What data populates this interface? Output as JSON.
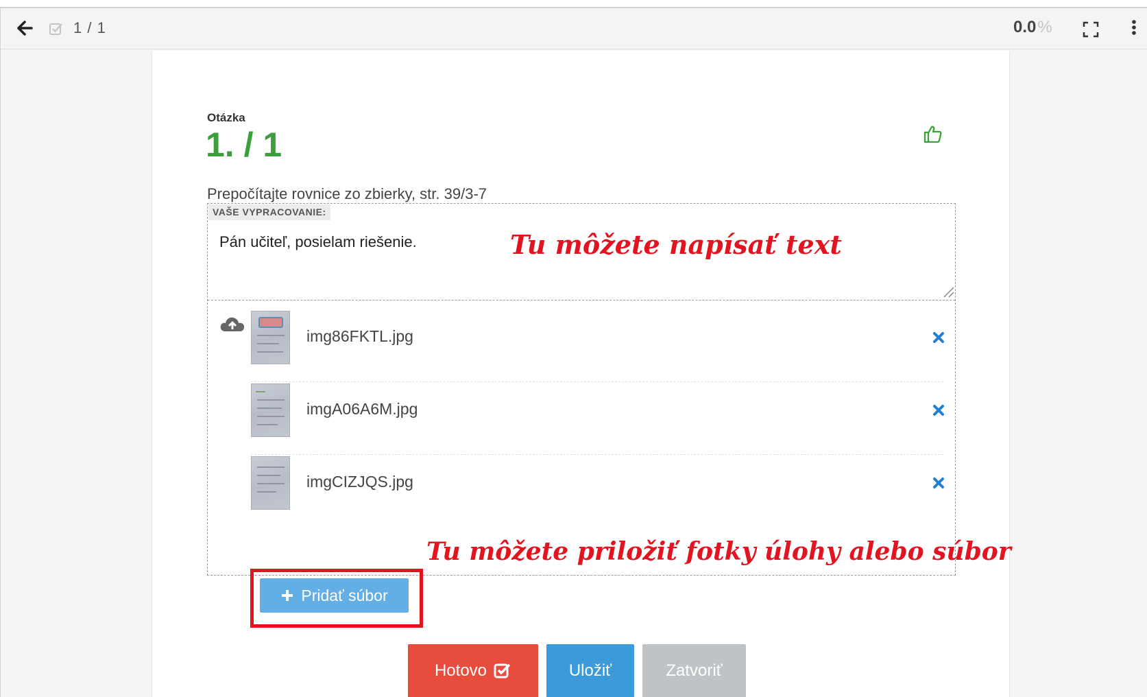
{
  "toolbar": {
    "counter": "1 / 1",
    "percent_value": "0.0",
    "percent_unit": "%"
  },
  "question": {
    "label": "Otázka",
    "number": "1. / 1",
    "text": "Prepočítajte rovnice zo zbierky, str. 39/3-7"
  },
  "answer": {
    "label": "VAŠE VYPRACOVANIE:",
    "text": "Pán učiteľ, posielam riešenie."
  },
  "files": [
    {
      "name": "img86FKTL.jpg"
    },
    {
      "name": "imgA06A6M.jpg"
    },
    {
      "name": "imgCIZJQS.jpg"
    }
  ],
  "add_file_label": "Pridať súbor",
  "annotations": {
    "text_hint": "Tu môžete napísať text",
    "file_hint": "Tu môžete priložiť fotky úlohy alebo súbor"
  },
  "buttons": {
    "done": "Hotovo",
    "save": "Uložiť",
    "close": "Zatvoriť"
  },
  "colors": {
    "accent_green": "#3aa13a",
    "done_red": "#e84c3d",
    "save_blue": "#3b9ad9",
    "close_gray": "#c0c3c5",
    "add_blue": "#63aee5",
    "annotation_red": "#e1141f",
    "remove_blue": "#1f7fd6"
  },
  "icons": [
    "back-arrow-icon",
    "checkbox-icon",
    "fullscreen-icon",
    "more-vertical-icon",
    "thumbs-up-icon",
    "cloud-upload-icon",
    "remove-icon",
    "plus-icon",
    "check-square-icon"
  ]
}
